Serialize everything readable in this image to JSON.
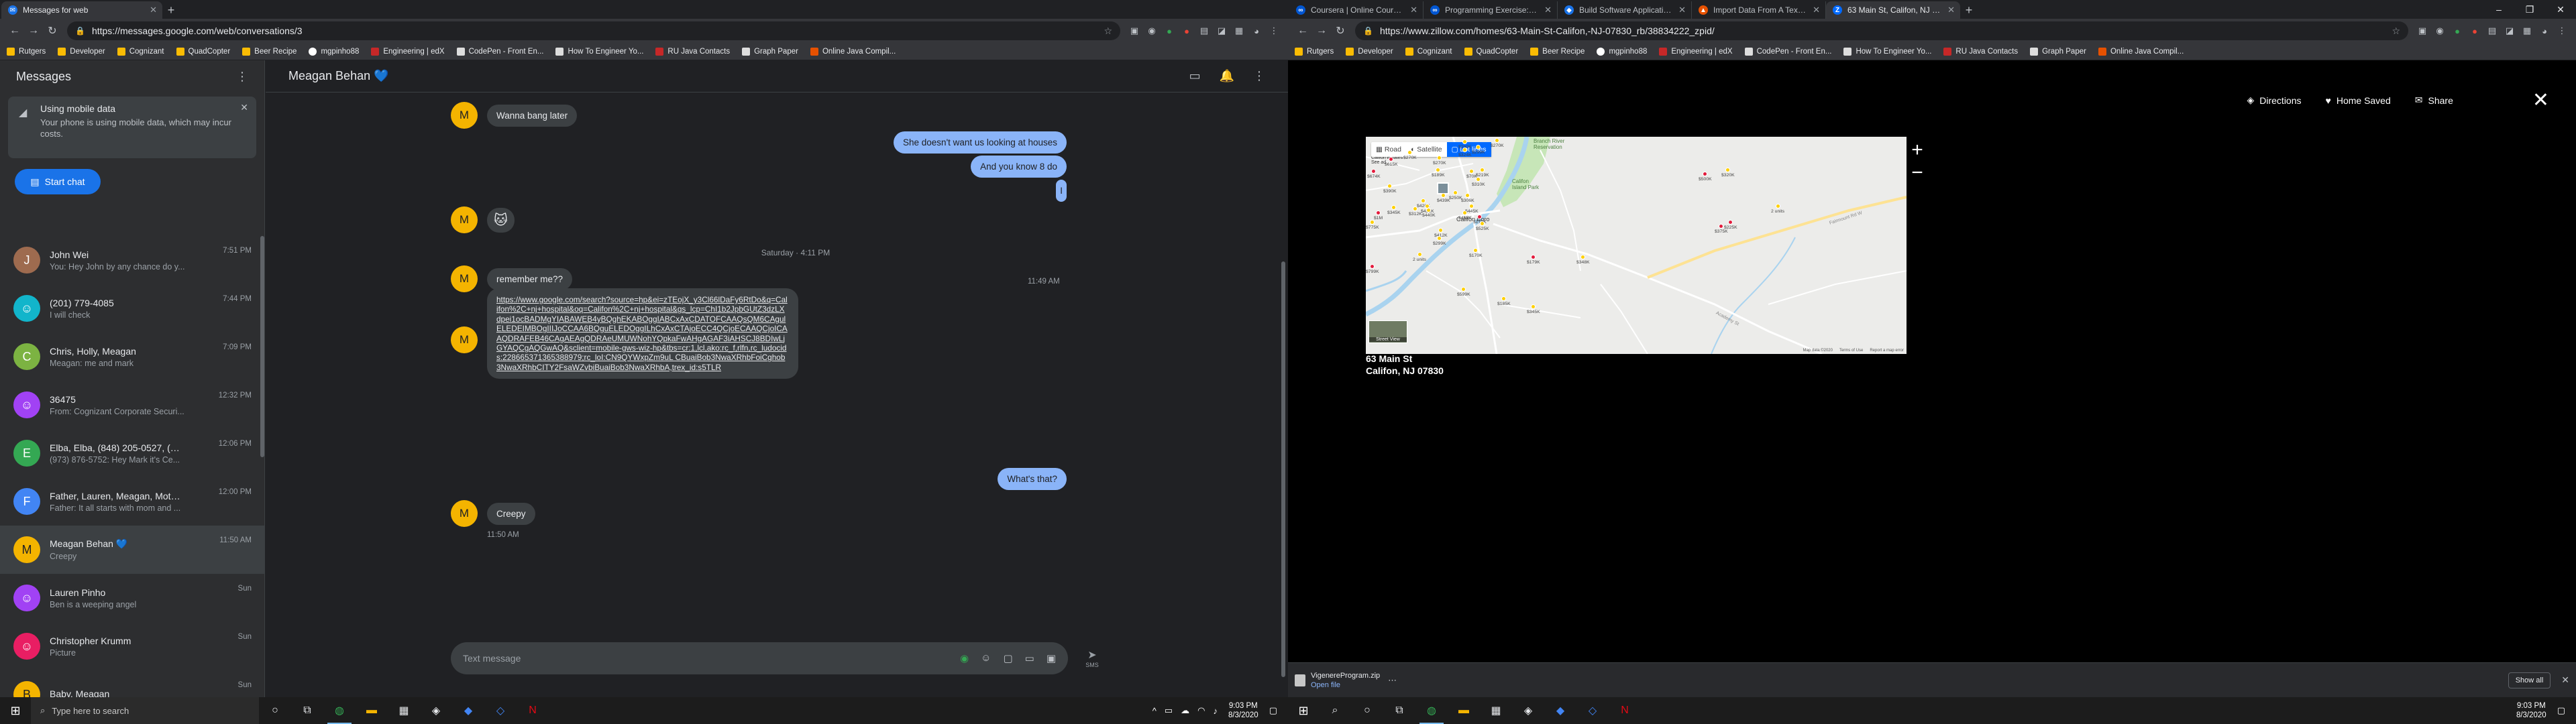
{
  "left_browser": {
    "tabs": [
      {
        "label": "Messages for web",
        "active": true
      }
    ],
    "url": "https://messages.google.com/web/conversations/3",
    "bookmarks": [
      "Rutgers",
      "Developer",
      "Cognizant",
      "QuadCopter",
      "Beer Recipe",
      "mgpinho88",
      "Engineering | edX",
      "CodePen - Front En...",
      "How To Engineer Yo...",
      "RU Java Contacts",
      "Graph Paper",
      "Online Java Compil..."
    ]
  },
  "messages": {
    "app_title": "Messages",
    "mobile_card": {
      "title": "Using mobile data",
      "body": "Your phone is using mobile data, which may incur costs."
    },
    "start_chat": "Start chat",
    "conversations": [
      {
        "name": "John Wei",
        "snippet": "You: Hey John by any chance do y...",
        "time": "7:51 PM",
        "color": "#9e6b4f",
        "initial": "J"
      },
      {
        "name": "(201) 779-4085",
        "snippet": "I will check",
        "time": "7:44 PM",
        "color": "#12b5cb",
        "initial": "☺"
      },
      {
        "name": "Chris, Holly, Meagan",
        "snippet": "Meagan: me and mark",
        "time": "7:09 PM",
        "color": "#7cb342",
        "initial": "C"
      },
      {
        "name": "36475",
        "snippet": "From: Cognizant Corporate Securi...",
        "time": "12:32 PM",
        "color": "#a142f4",
        "initial": "☺"
      },
      {
        "name": "Elba, Elba, (848) 205-0527, (973...",
        "snippet": "(973) 876-5752: Hey Mark it's Ce...",
        "time": "12:06 PM",
        "color": "#34a853",
        "initial": "E"
      },
      {
        "name": "Father, Lauren, Meagan, Mother...",
        "snippet": "Father: It all starts with mom and ...",
        "time": "12:00 PM",
        "color": "#4285f4",
        "initial": "F"
      },
      {
        "name": "Meagan Behan 💙",
        "snippet": "Creepy",
        "time": "11:50 AM",
        "color": "#f4b400",
        "initial": "M"
      },
      {
        "name": "Lauren Pinho",
        "snippet": "Ben is a weeping angel",
        "time": "Sun",
        "color": "#a142f4",
        "initial": "☺"
      },
      {
        "name": "Christopher Krumm",
        "snippet": "Picture",
        "time": "Sun",
        "color": "#e91e63",
        "initial": "☺"
      },
      {
        "name": "Baby, Meagan",
        "snippet": "",
        "time": "Sun",
        "color": "#f4b400",
        "initial": "B"
      }
    ],
    "chat_header": "Meagan Behan 💙",
    "thread": {
      "msg_wanna_bang": "Wanna bang later",
      "msg_doesnt_want": "She doesn't want us looking at houses",
      "msg_and_you_know": "And you know 8 do",
      "msg_i": "I",
      "msg_emoji": "🐱",
      "day_sep": "Saturday · 4:11 PM",
      "msg_remember": "remember me??",
      "time_1145": "11:49 AM",
      "link": "https://www.google.com/search?source=hp&ei=zTEojX_y3Cl66lDaFy6RtDo&q=Califon%2C+nj+hospital&oq=Califon%2C+nj+hospital&gs_lcp=ChI1b2JpbGUtZ3dzLXdpei1ocBADMgYIABAWEB4yBQghEKABOggIABCxAxCDATOFCAAQsQM6CAgulELEDEIMBOgIIIJoCCAA6BQguELEDOggILhCxAxCTAjoECC4QCjoECAAQCjoICAAQDRAFEB46CAgAEAgQDRAeUMUWNohYQpkaFwAHgAGAF3iAHSCJ8BDIwLjGYAQCgAQGwAQ&sclient=mobile-gws-wiz-hp&tbs=cr:1,lcl,ako:rc_f,rlfn,rc_ludocids:228665371365388979;rc_loI:CN9QYWxpZm9uL CBuaiBob3NwaXRhbFoiCghob3NwaXRhbCITY2FsaWZvbiBuaiBob3NwaXRhbA,trex_id:s5TLR",
      "msg_whats_that": "What's that?",
      "msg_creepy": "Creepy",
      "time_1150": "11:50 AM",
      "composer_placeholder": "Text message",
      "send_label": "SMS"
    }
  },
  "left_taskbar": {
    "search_placeholder": "Type here to search",
    "time": "9:03 PM",
    "date": "8/3/2020"
  },
  "right_browser": {
    "tabs": [
      {
        "label": "Coursera | Online Courses & Cr...",
        "active": false
      },
      {
        "label": "Programming Exercise: Known l...",
        "active": false
      },
      {
        "label": "Build Software Applications",
        "active": false
      },
      {
        "label": "Import Data From A Text File In...",
        "active": false
      },
      {
        "label": "63 Main St, Califon, NJ 07830 | ...",
        "active": true
      }
    ],
    "url": "https://www.zillow.com/homes/63-Main-St-Califon,-NJ-07830_rb/38834222_zpid/",
    "bookmarks": [
      "Rutgers",
      "Developer",
      "Cognizant",
      "QuadCopter",
      "Beer Recipe",
      "mgpinho88",
      "Engineering | edX",
      "CodePen - Front En...",
      "How To Engineer Yo...",
      "RU Java Contacts",
      "Graph Paper",
      "Online Java Compil..."
    ]
  },
  "zillow": {
    "actions": {
      "directions": "Directions",
      "home_saved": "Home Saved",
      "share": "Share"
    },
    "map_types": {
      "road": "Road",
      "satellite": "Satellite",
      "lot_lines": "Lot lines"
    },
    "map_labels": {
      "branch_river": "Branch River\nReservation",
      "califon_island": "Califon\nIsland Park",
      "califon_boro": "Califon Boro",
      "califon_estates": "Califon Estates\nSee ad",
      "fairmount_rd": "Fairmount Rd W",
      "academy_st": "Academy St",
      "street_view": "Street View",
      "map_data": "Map data ©2020",
      "terms": "Terms of Use",
      "report": "Report a map error"
    },
    "pins": [
      {
        "label": "$270K"
      },
      {
        "label": "$290K"
      },
      {
        "label": "$299K"
      },
      {
        "label": "$270K"
      },
      {
        "label": "$324K"
      },
      {
        "label": "$270K"
      },
      {
        "label": "$674K"
      },
      {
        "label": "$615K"
      },
      {
        "label": "$189K"
      },
      {
        "label": "$70K"
      },
      {
        "label": "$219K"
      },
      {
        "label": "$310K"
      },
      {
        "label": "$390K"
      },
      {
        "label": "$250K"
      },
      {
        "label": "$306K"
      },
      {
        "label": "$439K"
      },
      {
        "label": "$420K"
      },
      {
        "label": "$451K"
      },
      {
        "label": "$345K"
      },
      {
        "label": "$312K"
      },
      {
        "label": "$440K"
      },
      {
        "label": "$445K"
      },
      {
        "label": "$455K"
      },
      {
        "label": "$1M"
      },
      {
        "label": "$179K"
      },
      {
        "label": "$525K"
      },
      {
        "label": "$775K"
      },
      {
        "label": "$412K"
      },
      {
        "label": "$299K"
      },
      {
        "label": "2 units"
      },
      {
        "label": "$170K"
      },
      {
        "label": "$799K"
      },
      {
        "label": "$179K"
      },
      {
        "label": "$348K"
      },
      {
        "label": "$599K"
      },
      {
        "label": "$185K"
      },
      {
        "label": "$345K"
      },
      {
        "label": "$500K"
      },
      {
        "label": "$320K"
      },
      {
        "label": "2 units"
      },
      {
        "label": "$225K"
      },
      {
        "label": "$375K"
      }
    ],
    "address_line1": "63 Main St",
    "address_line2": "Califon, NJ 07830"
  },
  "download_bar": {
    "file": "VigenereProgram.zip",
    "open": "Open file",
    "show_all": "Show all"
  },
  "right_taskbar": {
    "time": "9:03 PM",
    "date": "8/3/2020"
  }
}
